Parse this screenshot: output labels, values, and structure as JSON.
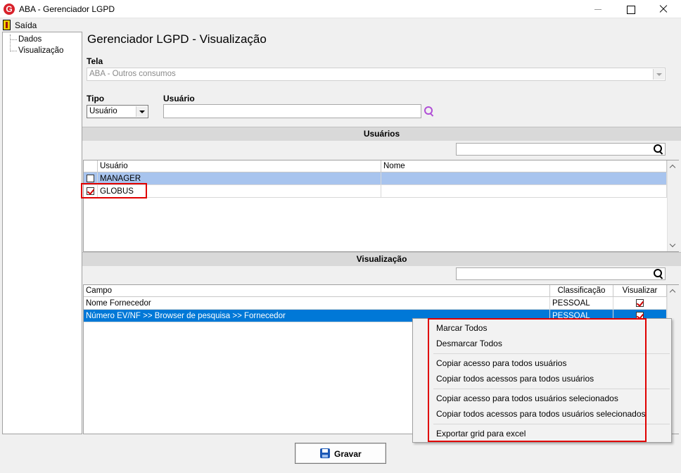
{
  "window": {
    "title": "ABA - Gerenciador LGPD",
    "icon_letter": "G"
  },
  "menu": {
    "exit_label": "Saída"
  },
  "tree": {
    "items": [
      "Dados",
      "Visualização"
    ]
  },
  "page": {
    "title": "Gerenciador LGPD - Visualização"
  },
  "tela": {
    "label": "Tela",
    "value": "ABA - Outros consumos"
  },
  "tipo": {
    "label": "Tipo",
    "value": "Usuário"
  },
  "usuario_field": {
    "label": "Usuário",
    "value": ""
  },
  "usuarios_section": {
    "title": "Usuários",
    "search_value": "",
    "columns": [
      "Usuário",
      "Nome"
    ],
    "rows": [
      {
        "checked": false,
        "usuario": "MANAGER",
        "nome": ""
      },
      {
        "checked": true,
        "usuario": "GLOBUS",
        "nome": ""
      }
    ]
  },
  "visualizacao_section": {
    "title": "Visualização",
    "search_value": "",
    "columns": [
      "Campo",
      "Classificação",
      "Visualizar"
    ],
    "rows": [
      {
        "campo": "Nome Fornecedor",
        "classificacao": "PESSOAL",
        "visualizar": true
      },
      {
        "campo": "Número  EV/NF >> Browser de pesquisa >> Fornecedor",
        "classificacao": "PESSOAL",
        "visualizar": true
      }
    ]
  },
  "context_menu": {
    "items": [
      "Marcar Todos",
      "Desmarcar Todos",
      "Copiar acesso para todos usuários",
      "Copiar todos acessos para todos usuários",
      "Copiar acesso para todos usuários selecionados",
      "Copiar todos acessos para todos usuários selecionados",
      "Exportar grid para excel"
    ]
  },
  "footer": {
    "save_label": "Gravar"
  },
  "colors": {
    "accent_red": "#e00000",
    "selection_blue": "#0078d7",
    "search_icon_purple": "#b04fd6"
  }
}
